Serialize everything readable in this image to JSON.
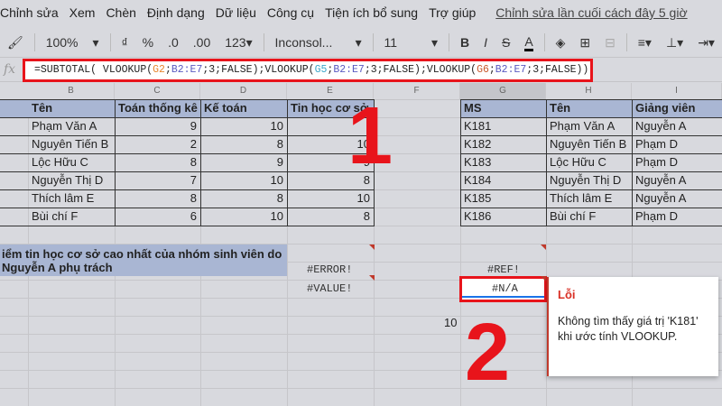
{
  "menu": [
    "Chỉnh sửa",
    "Xem",
    "Chèn",
    "Định dạng",
    "Dữ liệu",
    "Công cụ",
    "Tiện ích bổ sung",
    "Trợ giúp"
  ],
  "last_edit": "Chỉnh sửa lần cuối cách đây 5 giờ",
  "toolbar": {
    "zoom": "100%",
    "currency": "₫",
    "percent": "%",
    "dec_less": ".0",
    "dec_more": ".00",
    "format": "123▾",
    "font": "Inconsol...",
    "size": "11",
    "bold": "B",
    "italic": "I",
    "strike": "S",
    "color": "A"
  },
  "formula": {
    "fx": "fx",
    "p1": "=SUBTOTAL( VLOOKUP(",
    "g2": "G2",
    "p2": ";",
    "rng": "B2:E7",
    "p3": ";3;FALSE);VLOOKUP(",
    "g5": "G5",
    "p4": ";3;FALSE);VLOOKUP(",
    "g6": "G6",
    "p5": ";3;FALSE))"
  },
  "columns": [
    "B",
    "C",
    "D",
    "E",
    "F",
    "G",
    "H",
    "I"
  ],
  "table1": {
    "headers": [
      "Tên",
      "Toán thống kê",
      "Kế toán",
      "Tin học cơ sở"
    ],
    "rows": [
      [
        "Phạm Văn A",
        "9",
        "10",
        ""
      ],
      [
        "Nguyên Tiến B",
        "2",
        "8",
        "10"
      ],
      [
        "Lộc Hữu C",
        "8",
        "9",
        "9"
      ],
      [
        "Nguyễn Thị D",
        "7",
        "10",
        "8"
      ],
      [
        "Thích lâm E",
        "8",
        "8",
        "10"
      ],
      [
        "Bùi chí F",
        "6",
        "10",
        "8"
      ]
    ]
  },
  "table2": {
    "headers": [
      "MS",
      "Tên",
      "Giảng viên"
    ],
    "rows": [
      [
        "K181",
        "Phạm Văn A",
        "Nguyễn A"
      ],
      [
        "K182",
        "Nguyên Tiến B",
        "Phạm D"
      ],
      [
        "K183",
        "Lộc Hữu C",
        "Phạm D"
      ],
      [
        "K184",
        "Nguyễn Thị D",
        "Nguyễn A"
      ],
      [
        "K185",
        "Thích lâm E",
        "Nguyễn A"
      ],
      [
        "K186",
        "Bùi chí F",
        "Phạm D"
      ]
    ]
  },
  "question": {
    "line1": "iểm tin học cơ sở cao nhất của nhóm sinh viên do",
    "line2": "Nguyễn A phụ trách"
  },
  "errors": {
    "e1": "#ERROR!",
    "e2": "#VALUE!",
    "g1": "#REF!",
    "g2": "#N/A",
    "ten": "10"
  },
  "tooltip": {
    "title": "Lỗi",
    "message": "Không tìm thấy giá trị 'K181' khi ước tính VLOOKUP."
  },
  "annotations": {
    "one": "1",
    "two": "2"
  }
}
